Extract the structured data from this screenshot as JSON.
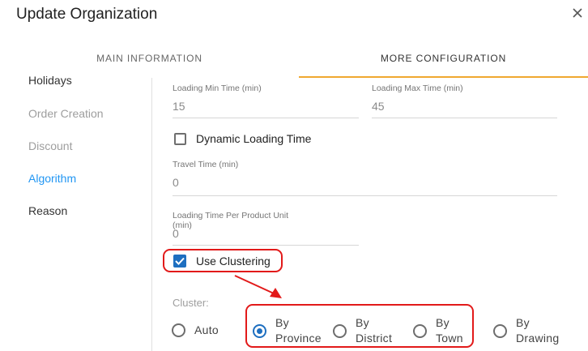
{
  "dialog": {
    "title": "Update Organization"
  },
  "tabs": [
    {
      "label": "MAIN INFORMATION"
    },
    {
      "label": "MORE CONFIGURATION"
    }
  ],
  "sidebar": {
    "items": [
      {
        "label": "Holidays"
      },
      {
        "label": "Order Creation"
      },
      {
        "label": "Discount"
      },
      {
        "label": "Algorithm"
      },
      {
        "label": "Reason"
      }
    ]
  },
  "form": {
    "loading_min_time": {
      "label": "Loading Min Time (min)",
      "value": "15"
    },
    "loading_max_time": {
      "label": "Loading Max Time (min)",
      "value": "45"
    },
    "dynamic_loading_time": {
      "label": "Dynamic Loading Time",
      "checked": false
    },
    "travel_time": {
      "label": "Travel Time (min)",
      "value": "0"
    },
    "loading_time_per_unit": {
      "label_line1": "Loading Time Per Product Unit",
      "label_line2": "(min)",
      "value": "0"
    },
    "use_clustering": {
      "label": "Use Clustering",
      "checked": true
    },
    "cluster": {
      "label": "Cluster:",
      "selected": "By Province",
      "options": [
        {
          "line1": "Auto",
          "line2": ""
        },
        {
          "line1": "By",
          "line2": "Province"
        },
        {
          "line1": "By",
          "line2": "District"
        },
        {
          "line1": "By",
          "line2": "Town"
        },
        {
          "line1": "By",
          "line2": "Drawing"
        }
      ]
    }
  },
  "colors": {
    "accent_blue": "#1e6fc0",
    "active_sidebar": "#2196f3",
    "tab_indicator": "#f0a830",
    "annotation_red": "#e21a1a"
  }
}
